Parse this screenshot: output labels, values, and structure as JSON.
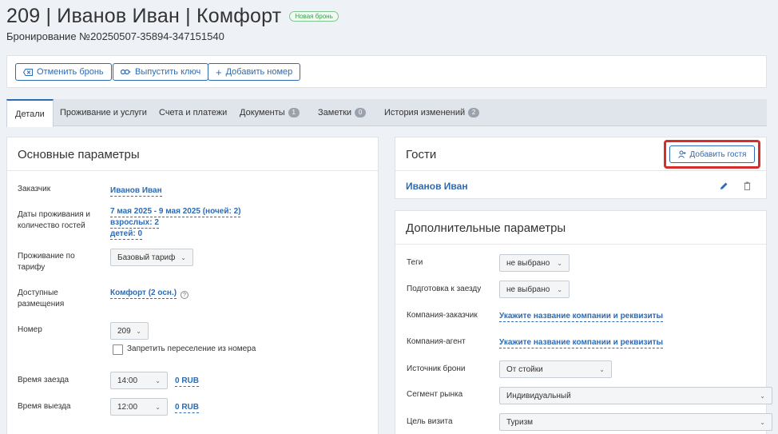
{
  "header": {
    "title": "209 | Иванов Иван | Комфорт",
    "status_badge": "Новая бронь",
    "booking_number": "Бронирование №20250507-35894-347151540"
  },
  "toolbar": {
    "cancel_label": "Отменить бронь",
    "issue_key_label": "Выпустить ключ",
    "add_room_label": "Добавить номер"
  },
  "tabs": [
    {
      "label": "Детали",
      "active": true
    },
    {
      "label": "Проживание и услуги"
    },
    {
      "label": "Счета и платежи"
    },
    {
      "label": "Документы",
      "count": "1"
    },
    {
      "label": "Заметки",
      "count": "0"
    },
    {
      "label": "История изменений",
      "count": "2"
    }
  ],
  "main_params": {
    "title": "Основные параметры",
    "customer_label": "Заказчик",
    "customer_value": "Иванов Иван",
    "dates_label": "Даты проживания и количество гостей",
    "dates_value": "7 мая 2025 - 9 мая 2025 (ночей: 2)",
    "adults_value": "взрослых: 2",
    "children_value": "детей: 0",
    "rate_label": "Проживание по тарифу",
    "rate_value": "Базовый тариф",
    "available_label": "Доступные размещения",
    "available_value": "Комфорт (2 осн.)",
    "room_label": "Номер",
    "room_value": "209",
    "forbid_move_label": "Запретить переселение из номера",
    "checkin_label": "Время заезда",
    "checkin_value": "14:00",
    "checkin_price": "0 RUB",
    "checkout_label": "Время выезда",
    "checkout_value": "12:00",
    "checkout_price": "0 RUB"
  },
  "guests": {
    "title": "Гости",
    "add_guest_label": "Добавить гостя",
    "guest_name": "Иванов Иван"
  },
  "extra_params": {
    "title": "Дополнительные параметры",
    "tags_label": "Теги",
    "tags_value": "не выбрано",
    "prep_label": "Подготовка к заезду",
    "prep_value": "не выбрано",
    "company_customer_label": "Компания-заказчик",
    "company_customer_value": "Укажите название компании и реквизиты",
    "company_agent_label": "Компания-агент",
    "company_agent_value": "Укажите название компании и реквизиты",
    "source_label": "Источник брони",
    "source_value": "От стойки",
    "segment_label": "Сегмент рынка",
    "segment_value": "Индивидуальный",
    "purpose_label": "Цель визита",
    "purpose_value": "Туризм"
  },
  "colors": {
    "accent": "#2d6bb3",
    "highlight": "#d62d2d",
    "badge_green": "#3aa04d"
  }
}
